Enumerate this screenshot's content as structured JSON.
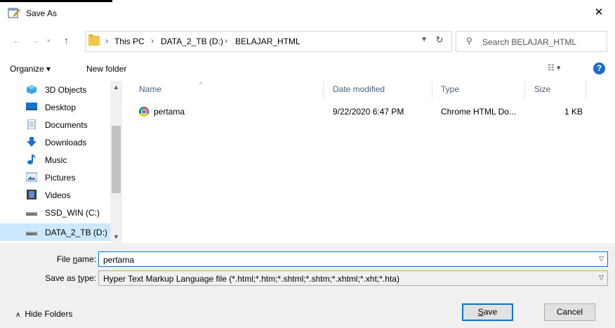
{
  "window": {
    "title": "Save As",
    "close_icon": "close-icon"
  },
  "address_bar": {
    "crumbs": [
      "This PC",
      "DATA_2_TB (D:)",
      "BELAJAR_HTML"
    ],
    "search_placeholder": "Search BELAJAR_HTML"
  },
  "toolbar": {
    "organize": "Organize ▾",
    "new_folder": "New folder"
  },
  "nav": {
    "items": [
      {
        "label": "3D Objects",
        "icon": "3d-objects-icon"
      },
      {
        "label": "Desktop",
        "icon": "desktop-icon"
      },
      {
        "label": "Documents",
        "icon": "documents-icon"
      },
      {
        "label": "Downloads",
        "icon": "downloads-icon"
      },
      {
        "label": "Music",
        "icon": "music-icon"
      },
      {
        "label": "Pictures",
        "icon": "pictures-icon"
      },
      {
        "label": "Videos",
        "icon": "videos-icon"
      },
      {
        "label": "SSD_WIN (C:)",
        "icon": "drive-icon"
      },
      {
        "label": "DATA_2_TB (D:)",
        "icon": "drive-icon",
        "selected": true
      }
    ]
  },
  "columns": {
    "name": "Name",
    "date": "Date modified",
    "type": "Type",
    "size": "Size"
  },
  "files": [
    {
      "name": "pertama",
      "date": "9/22/2020 6:47 PM",
      "type": "Chrome HTML Do...",
      "size": "1 KB",
      "icon": "chrome-icon"
    }
  ],
  "form": {
    "filename_label_pre": "File ",
    "filename_label_acc": "n",
    "filename_label_post": "ame:",
    "filename_value": "pertama",
    "savetype_label_pre": "Save as ",
    "savetype_label_acc": "t",
    "savetype_label_post": "ype:",
    "savetype_value": "Hyper Text Markup Language file (*.html;*.htm;*.shtml;*.shtm;*.xhtml;*.xht;*.hta)"
  },
  "buttons": {
    "hide_folders": "Hide Folders",
    "save_acc": "S",
    "save_rest": "ave",
    "cancel": "Cancel"
  },
  "colors": {
    "accent": "#0078d7",
    "selection": "#cce8ff",
    "help": "#1e6cc4"
  }
}
